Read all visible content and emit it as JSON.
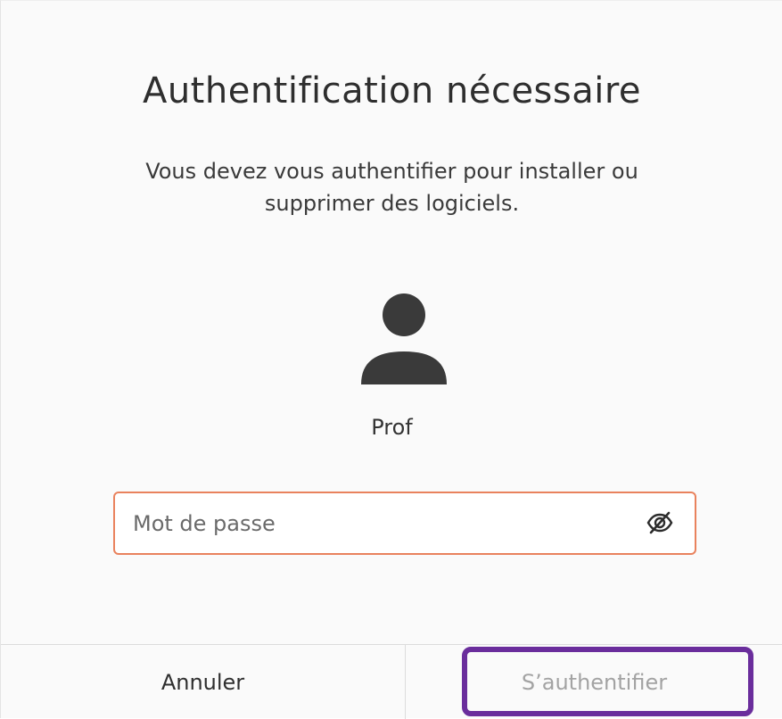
{
  "dialog": {
    "title": "Authentification nécessaire",
    "message_line1": "Vous devez vous authentifier pour installer ou",
    "message_line2": "supprimer des logiciels.",
    "user": {
      "avatar_icon": "user-avatar-icon",
      "name": "Prof"
    },
    "password": {
      "value": "",
      "placeholder": "Mot de passe",
      "reveal_icon": "eye-slash-icon"
    },
    "buttons": {
      "cancel_label": "Annuler",
      "authenticate_label": "S’authentifier"
    },
    "colors": {
      "field_border": "#e9825d",
      "highlight": "#6a2d9c",
      "disabled_text": "#a3a3a3"
    }
  }
}
